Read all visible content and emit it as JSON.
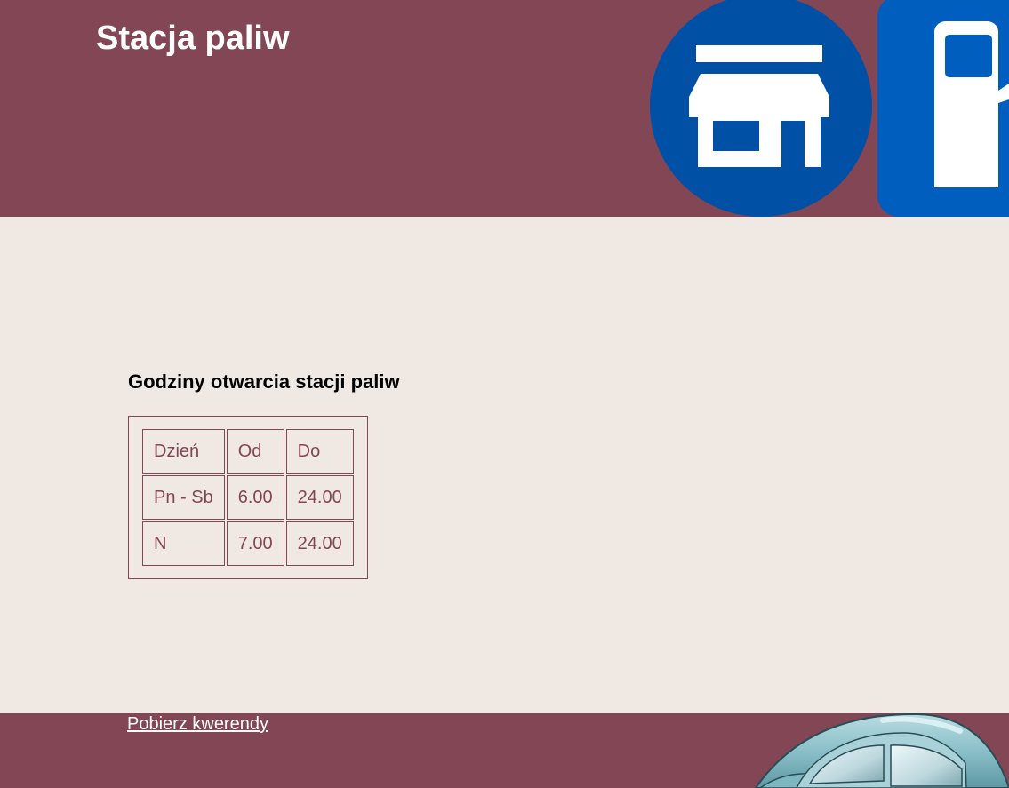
{
  "header": {
    "title": "Stacja paliw",
    "icons": [
      "store-icon",
      "fuel-pump-icon"
    ]
  },
  "main": {
    "heading": "Godziny otwarcia stacji paliw",
    "hours_table": {
      "rows": [
        [
          "Dzień",
          "Od",
          "Do"
        ],
        [
          "Pn - Sb",
          "6.00",
          "24.00"
        ],
        [
          "N",
          "7.00",
          "24.00"
        ]
      ]
    }
  },
  "footer": {
    "link_label": "Pobierz kwerendy",
    "image": "car-image"
  },
  "colors": {
    "brand": "#834654",
    "background": "#f0e8e3",
    "icon_blue": "#0050a6",
    "pump_blue": "#005ebf",
    "text": "#ffffff"
  }
}
